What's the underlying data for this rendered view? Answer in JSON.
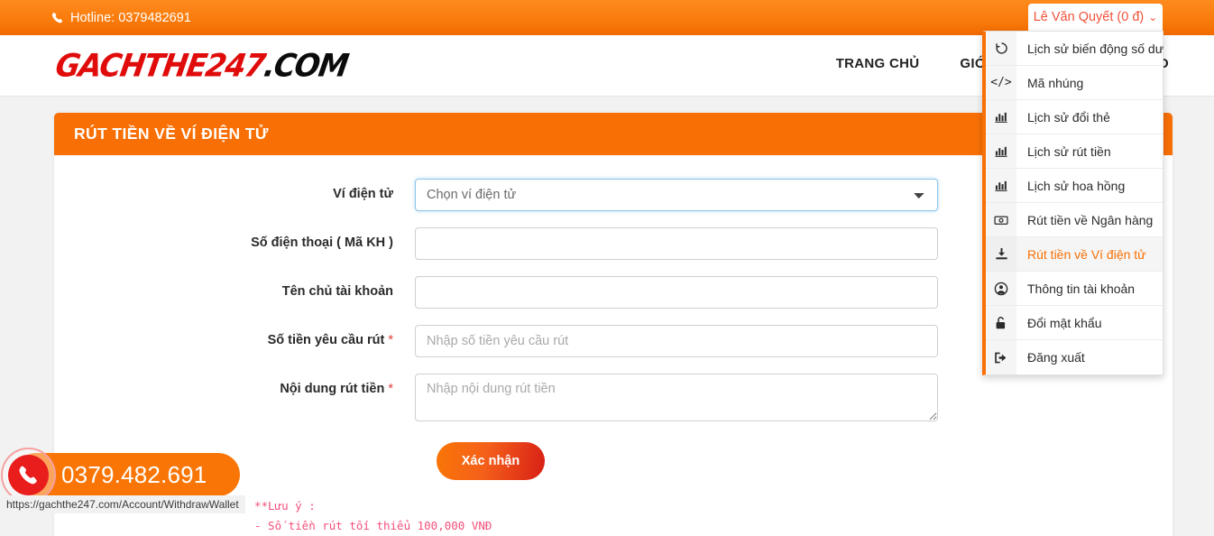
{
  "topbar": {
    "hotline": "Hotline: 0379482691",
    "phone_icon": "phone-icon",
    "user_button": "Lê Văn Quyết (0 đ)",
    "user_caret": "⌄"
  },
  "header": {
    "logo_red": "GACHTHE247",
    "logo_black": ".COM",
    "nav": [
      {
        "label": "TRANG CHỦ"
      },
      {
        "label": "GIỚI THIỆU"
      },
      {
        "label": "ĐỔI THẺ CÀO"
      }
    ]
  },
  "dropdown": {
    "items": [
      {
        "label": "Lịch sử biến động số dư",
        "icon": "history-icon",
        "active": false
      },
      {
        "label": "Mã nhúng",
        "icon": "code-icon",
        "active": false
      },
      {
        "label": "Lịch sử đổi thẻ",
        "icon": "chart-bar-icon",
        "active": false
      },
      {
        "label": "Lịch sử rút tiền",
        "icon": "chart-bar-icon",
        "active": false
      },
      {
        "label": "Lịch sử hoa hồng",
        "icon": "chart-bar-icon",
        "active": false
      },
      {
        "label": "Rút tiền về Ngân hàng",
        "icon": "banknote-icon",
        "active": false
      },
      {
        "label": "Rút tiền về Ví điện tử",
        "icon": "download-tray-icon",
        "active": true
      },
      {
        "label": "Thông tin tài khoản",
        "icon": "user-circle-icon",
        "active": false
      },
      {
        "label": "Đổi mật khẩu",
        "icon": "unlock-icon",
        "active": false
      },
      {
        "label": "Đăng xuất",
        "icon": "logout-icon",
        "active": false
      }
    ]
  },
  "card": {
    "title": "RÚT TIỀN VỀ VÍ ĐIỆN TỬ",
    "fields": {
      "wallet": {
        "label": "Ví điện tử",
        "selected": "Chọn ví điện tử",
        "options": [
          "Chọn ví điện tử"
        ]
      },
      "phone": {
        "label": "Số điện thoại ( Mã KH )",
        "value": "",
        "placeholder": ""
      },
      "account_name": {
        "label": "Tên chủ tài khoản",
        "value": "",
        "placeholder": ""
      },
      "amount": {
        "label": "Số tiền yêu cầu rút",
        "required_mark": "*",
        "value": "",
        "placeholder": "Nhập số tiền yêu cầu rút"
      },
      "content": {
        "label": "Nội dung rút tiền",
        "required_mark": "*",
        "value": "",
        "placeholder": "Nhập nội dung rút tiền"
      }
    },
    "submit_label": "Xác nhận",
    "notes": {
      "line1": "**Lưu ý :",
      "line2": "- Số tiền rút tối thiểu 100,000 VNĐ"
    }
  },
  "phone_widget": {
    "number": "0379.482.691",
    "icon": "phone-call-icon"
  },
  "status_bar": {
    "url": "https://gachthe247.com/Account/WithdrawWallet"
  },
  "colors": {
    "brand_orange": "#f87005",
    "brand_red": "#e00b0b",
    "link_orange": "#f0523a",
    "note_pink": "#f4507a"
  }
}
